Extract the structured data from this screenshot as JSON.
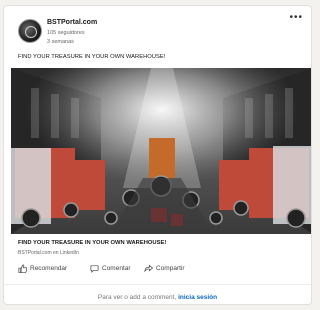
{
  "post": {
    "author": "BSTPortal.com",
    "followers": "105 seguidores",
    "time": "3 semanas",
    "more_icon": "ellipsis-icon",
    "text": "FIND YOUR TREASURE IN YOUR OWN WAREHOUSE!",
    "link_title": "FIND YOUR TREASURE IN YOUR OWN WAREHOUSE!",
    "link_source": "BSTPortal.com en LinkedIn"
  },
  "actions": {
    "like": "Recomendar",
    "comment": "Comentar",
    "share": "Compartir"
  },
  "footer": {
    "prompt": "Para ver o add a comment, ",
    "login": "inicia sesión"
  },
  "colors": {
    "link": "#0a66c2",
    "background": "#f3f2ef"
  }
}
